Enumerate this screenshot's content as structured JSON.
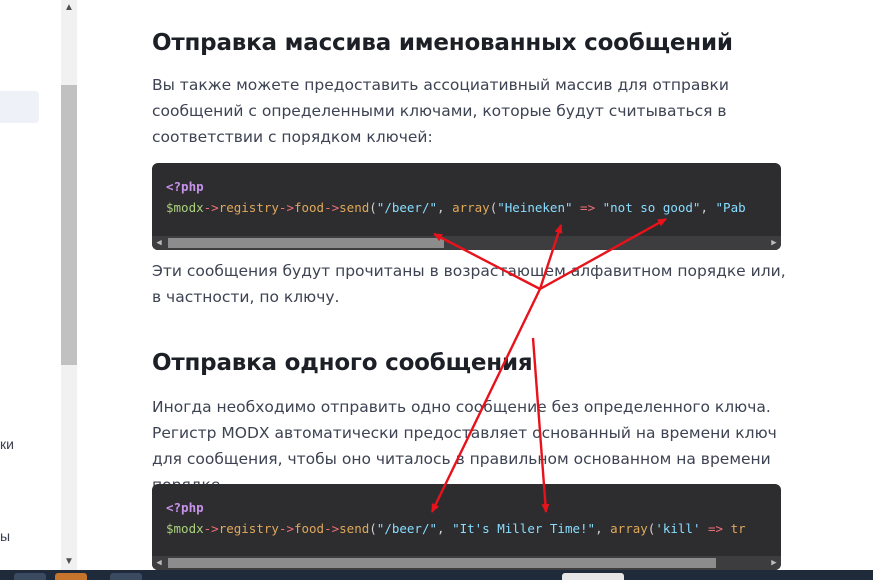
{
  "sidebar": {
    "fragments": [
      "ки",
      "ы"
    ]
  },
  "section1": {
    "title": "Отправка массива именованных сообщений",
    "intro": "Вы также можете предоставить ассоциативный массив для отправки сообщений с определенными ключами, которые будут считываться в соответствии с порядком ключей:",
    "code_open_tag": "<?php",
    "code_tokens": [
      {
        "t": "$modx",
        "c": "var"
      },
      {
        "t": "->",
        "c": "op"
      },
      {
        "t": "registry",
        "c": "fn"
      },
      {
        "t": "->",
        "c": "op"
      },
      {
        "t": "food",
        "c": "fn"
      },
      {
        "t": "->",
        "c": "op"
      },
      {
        "t": "send",
        "c": "fn"
      },
      {
        "t": "(",
        "c": "punc"
      },
      {
        "t": "\"/beer/\"",
        "c": "str"
      },
      {
        "t": ", ",
        "c": "punc"
      },
      {
        "t": "array",
        "c": "fn"
      },
      {
        "t": "(",
        "c": "punc"
      },
      {
        "t": "\"Heineken\"",
        "c": "str"
      },
      {
        "t": " => ",
        "c": "op"
      },
      {
        "t": "\"not so good\"",
        "c": "str"
      },
      {
        "t": ", ",
        "c": "punc"
      },
      {
        "t": "\"Pab",
        "c": "str"
      }
    ],
    "outro": "Эти сообщения будут прочитаны в возрастающем алфавитном порядке или, в частности, по ключу."
  },
  "section2": {
    "title": "Отправка одного сообщения",
    "intro": "Иногда необходимо отправить одно сообщение без определенного ключа. Регистр MODX автоматически предоставляет основанный на времени ключ для сообщения, чтобы оно читалось в правильном основанном на времени порядке.",
    "code_open_tag": "<?php",
    "code_tokens": [
      {
        "t": "$modx",
        "c": "var"
      },
      {
        "t": "->",
        "c": "op"
      },
      {
        "t": "registry",
        "c": "fn"
      },
      {
        "t": "->",
        "c": "op"
      },
      {
        "t": "food",
        "c": "fn"
      },
      {
        "t": "->",
        "c": "op"
      },
      {
        "t": "send",
        "c": "fn"
      },
      {
        "t": "(",
        "c": "punc"
      },
      {
        "t": "\"/beer/\"",
        "c": "str"
      },
      {
        "t": ", ",
        "c": "punc"
      },
      {
        "t": "\"It's Miller Time!\"",
        "c": "str"
      },
      {
        "t": ", ",
        "c": "punc"
      },
      {
        "t": "array",
        "c": "fn"
      },
      {
        "t": "(",
        "c": "punc"
      },
      {
        "t": "'kill'",
        "c": "str"
      },
      {
        "t": " => ",
        "c": "op"
      },
      {
        "t": "tr",
        "c": "fn"
      }
    ]
  },
  "colors": {
    "annotation_arrow": "#e8121b",
    "code_background": "#2d2d2f",
    "heading": "#1c1f26"
  }
}
